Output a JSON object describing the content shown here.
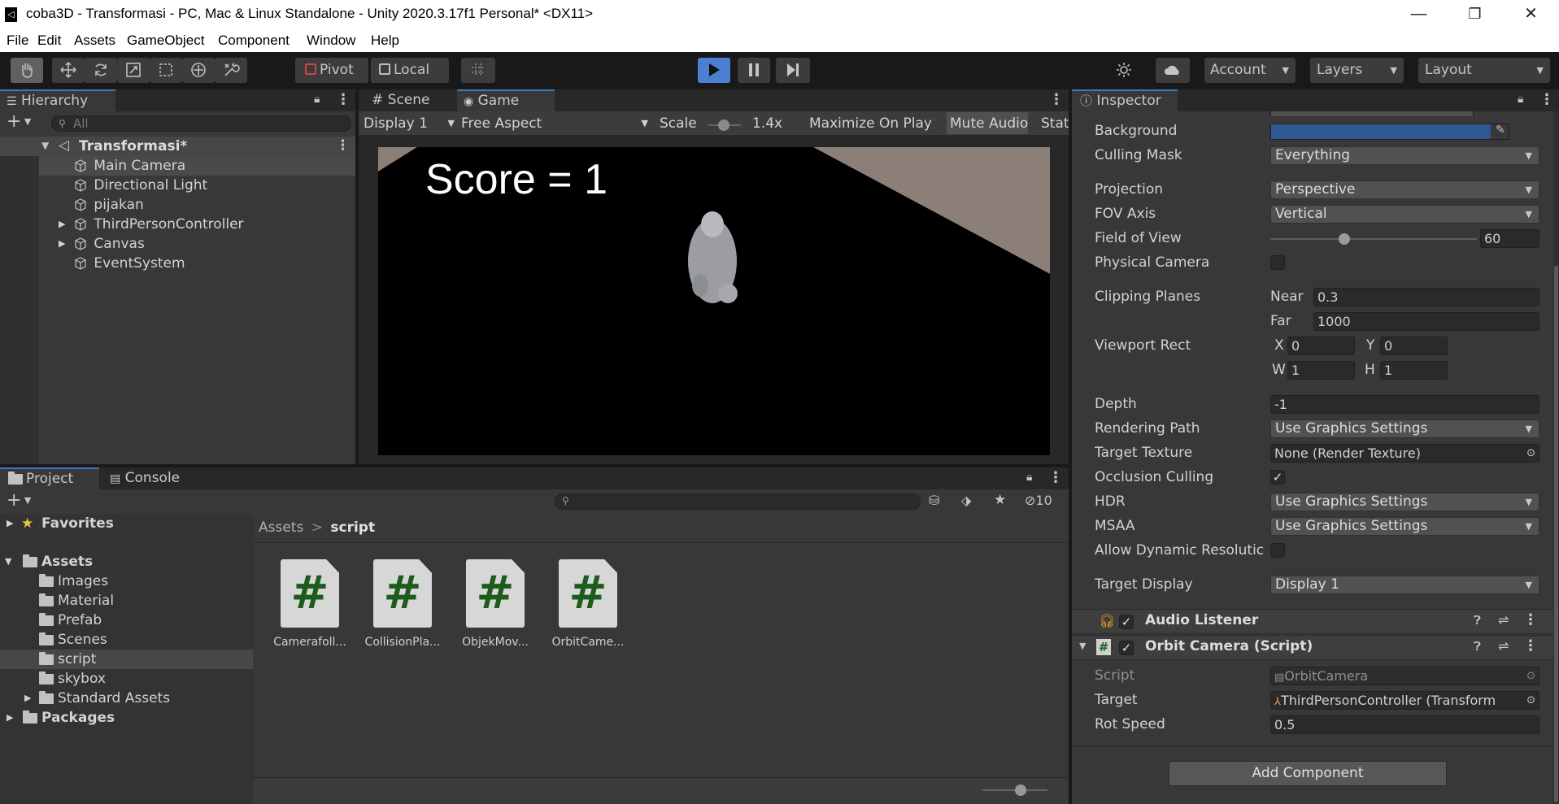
{
  "window": {
    "title": "coba3D - Transformasi - PC, Mac & Linux Standalone - Unity 2020.3.17f1 Personal* <DX11>",
    "minimize": "—",
    "maximize": "❐",
    "close": "✕"
  },
  "menu": [
    "File",
    "Edit",
    "Assets",
    "GameObject",
    "Component",
    "Window",
    "Help"
  ],
  "toolbar": {
    "pivot": "Pivot",
    "local": "Local",
    "account": "Account",
    "layers": "Layers",
    "layout": "Layout"
  },
  "hierarchy": {
    "tab": "Hierarchy",
    "search_placeholder": "All",
    "scene": "Transformasi*",
    "items": [
      "Main Camera",
      "Directional Light",
      "pijakan",
      "ThirdPersonController",
      "Canvas",
      "EventSystem"
    ]
  },
  "game_view": {
    "tabs": [
      "Scene",
      "Game"
    ],
    "display": "Display 1",
    "aspect": "Free Aspect",
    "scale_label": "Scale",
    "scale_value": "1.4x",
    "maximize_on_play": "Maximize On Play",
    "mute_audio": "Mute Audio",
    "stats": "Stat",
    "score_text": "Score = 1"
  },
  "project": {
    "tabs": [
      "Project",
      "Console"
    ],
    "hidden_count": "10",
    "tree": {
      "favorites": "Favorites",
      "assets": "Assets",
      "folders": [
        "Images",
        "Material",
        "Prefab",
        "Scenes",
        "script",
        "skybox",
        "Standard Assets"
      ],
      "packages": "Packages"
    },
    "breadcrumb": [
      "Assets",
      "script"
    ],
    "breadcrumb_sep": ">",
    "files": [
      "Camerafoll...",
      "CollisionPla...",
      "ObjekMov...",
      "OrbitCame..."
    ],
    "file_glyph": "#"
  },
  "inspector": {
    "tab": "Inspector",
    "camera": {
      "background_label": "Background",
      "background_color": "#2f5796",
      "culling_mask_label": "Culling Mask",
      "culling_mask": "Everything",
      "projection_label": "Projection",
      "projection": "Perspective",
      "fov_axis_label": "FOV Axis",
      "fov_axis": "Vertical",
      "fov_label": "Field of View",
      "fov": "60",
      "fov_fraction": 0.35,
      "physical_camera_label": "Physical Camera",
      "clipping_label": "Clipping Planes",
      "near_label": "Near",
      "near": "0.3",
      "far_label": "Far",
      "far": "1000",
      "viewport_label": "Viewport Rect",
      "x_label": "X",
      "x": "0",
      "y_label": "Y",
      "y": "0",
      "w_label": "W",
      "w": "1",
      "h_label": "H",
      "h": "1",
      "depth_label": "Depth",
      "depth": "-1",
      "rendering_path_label": "Rendering Path",
      "rendering_path": "Use Graphics Settings",
      "target_texture_label": "Target Texture",
      "target_texture": "None (Render Texture)",
      "occlusion_label": "Occlusion Culling",
      "hdr_label": "HDR",
      "hdr": "Use Graphics Settings",
      "msaa_label": "MSAA",
      "msaa": "Use Graphics Settings",
      "dynamic_res_label": "Allow Dynamic Resolutic",
      "target_display_label": "Target Display",
      "target_display": "Display 1"
    },
    "audio_listener": "Audio Listener",
    "orbit": {
      "title": "Orbit Camera (Script)",
      "script_label": "Script",
      "script": "OrbitCamera",
      "target_label": "Target",
      "target": "ThirdPersonController (Transform",
      "rot_speed_label": "Rot Speed",
      "rot_speed": "0.5"
    },
    "add_component": "Add Component"
  }
}
